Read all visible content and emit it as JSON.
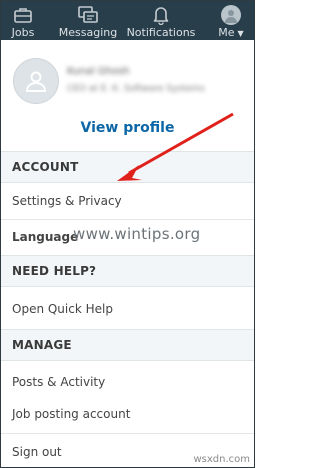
{
  "nav": {
    "items": [
      {
        "label": "Jobs",
        "icon": "briefcase-icon"
      },
      {
        "label": "Messaging",
        "icon": "messaging-icon"
      },
      {
        "label": "Notifications",
        "icon": "bell-icon"
      },
      {
        "label": "Me",
        "icon": "avatar-icon"
      }
    ]
  },
  "profile": {
    "name": "Kunal Ghosh",
    "headline": "CEO at E. K. Software Systems",
    "view_profile": "View profile"
  },
  "sections": {
    "account": {
      "header": "ACCOUNT",
      "items": [
        "Settings & Privacy",
        "Language"
      ]
    },
    "help": {
      "header": "NEED HELP?",
      "items": [
        "Open Quick Help"
      ]
    },
    "manage": {
      "header": "MANAGE",
      "items": [
        "Posts & Activity",
        "Job posting account"
      ]
    },
    "signout": "Sign out"
  },
  "watermark": "www.wintips.org",
  "corner_mark": "wsxdn.com",
  "colors": {
    "nav_bg": "#283e4a",
    "link": "#0a66a6",
    "arrow": "#e0201a"
  }
}
